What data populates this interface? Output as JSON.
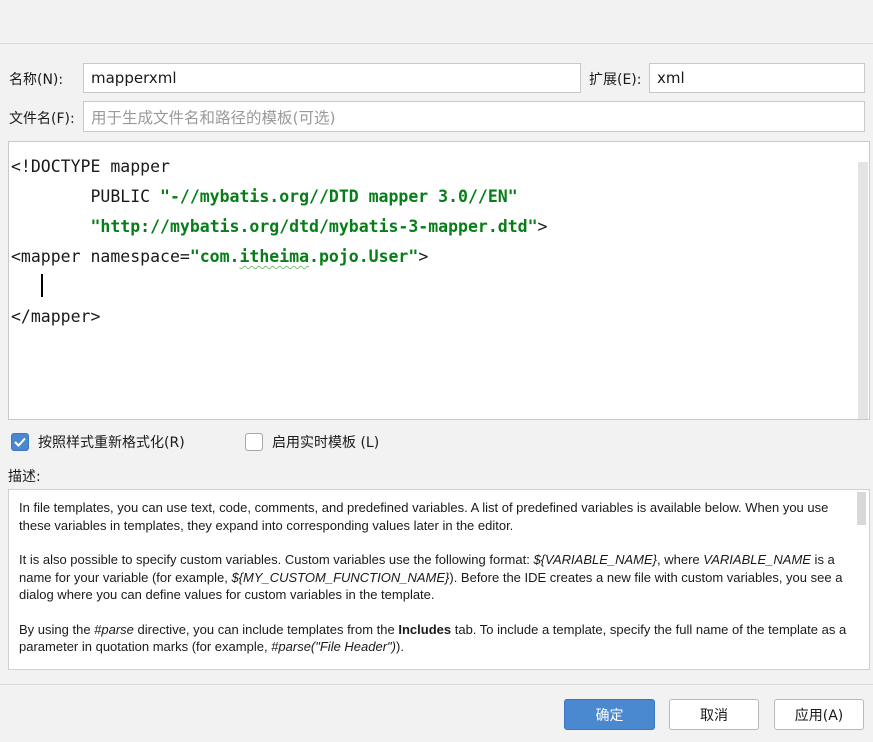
{
  "form": {
    "name_label": "名称(N):",
    "name_value": "mapperxml",
    "ext_label": "扩展(E):",
    "ext_value": "xml",
    "filename_label": "文件名(F):",
    "filename_placeholder": "用于生成文件名和路径的模板(可选)"
  },
  "editor": {
    "lines": [
      {
        "segments": [
          {
            "text": "<!DOCTYPE mapper",
            "style": "plain"
          }
        ]
      },
      {
        "segments": [
          {
            "text": "        PUBLIC ",
            "style": "plain"
          },
          {
            "text": "\"-//mybatis.org//DTD mapper 3.0//EN\"",
            "style": "str"
          }
        ]
      },
      {
        "segments": [
          {
            "text": "        ",
            "style": "plain"
          },
          {
            "text": "\"http://mybatis.org/dtd/mybatis-3-mapper.dtd\"",
            "style": "str"
          },
          {
            "text": ">",
            "style": "plain"
          }
        ]
      },
      {
        "segments": [
          {
            "text": "<mapper namespace=",
            "style": "plain"
          },
          {
            "text": "\"com.",
            "style": "str"
          },
          {
            "text": "itheima",
            "style": "str-underline"
          },
          {
            "text": ".pojo.User\"",
            "style": "str"
          },
          {
            "text": ">",
            "style": "plain"
          }
        ]
      },
      {
        "segments": [
          {
            "text": "   ",
            "style": "plain"
          },
          {
            "text": "",
            "style": "cursor"
          }
        ]
      },
      {
        "segments": [
          {
            "text": "</mapper>",
            "style": "plain"
          }
        ]
      }
    ]
  },
  "options": {
    "reformat_label": "按照样式重新格式化(R)",
    "reformat_checked": true,
    "live_template_label": "启用实时模板 (L)",
    "live_template_checked": false
  },
  "description": {
    "label": "描述:",
    "paragraphs": [
      [
        {
          "t": "In file templates, you can use text, code, comments, and predefined variables. A list of predefined variables is available below. When you use these variables in templates, they expand into corresponding values later in the editor."
        }
      ],
      [
        {
          "t": "It is also possible to specify custom variables. Custom variables use the following format: "
        },
        {
          "t": "${VARIABLE_NAME}",
          "s": "i"
        },
        {
          "t": ", where "
        },
        {
          "t": "VARIABLE_NAME",
          "s": "i"
        },
        {
          "t": " is a name for your variable (for example, "
        },
        {
          "t": "${MY_CUSTOM_FUNCTION_NAME}",
          "s": "i"
        },
        {
          "t": "). Before the IDE creates a new file with custom variables, you see a dialog where you can define values for custom variables in the template."
        }
      ],
      [
        {
          "t": "By using the "
        },
        {
          "t": "#parse",
          "s": "i"
        },
        {
          "t": " directive, you can include templates from the "
        },
        {
          "t": "Includes",
          "s": "b"
        },
        {
          "t": " tab. To include a template, specify the full name of the template as a parameter in quotation marks (for example, "
        },
        {
          "t": "#parse(\"File Header\")",
          "s": "i"
        },
        {
          "t": ")."
        }
      ]
    ]
  },
  "buttons": {
    "ok": "确定",
    "cancel": "取消",
    "apply": "应用(A)"
  },
  "colors": {
    "accent": "#4a88d0",
    "string_literal": "#067d17"
  },
  "icons": {
    "checkbox_checked": "checkmark-icon"
  }
}
